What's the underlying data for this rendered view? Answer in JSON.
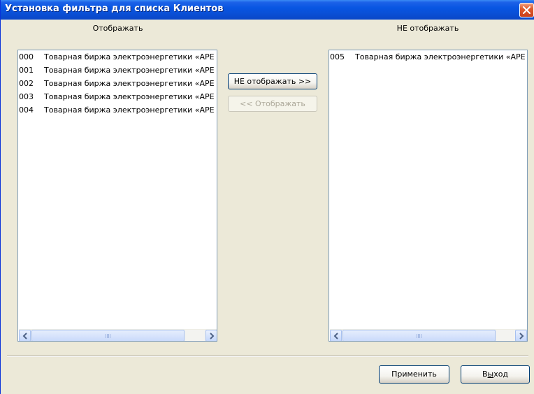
{
  "window": {
    "title": "Установка фильтра для списка Клиентов"
  },
  "left_panel": {
    "header": "Отображать",
    "items": [
      {
        "code": "000",
        "name": "Товарная биржа электроэнергетики «АРЕ"
      },
      {
        "code": "001",
        "name": "Товарная биржа электроэнергетики «АРЕ"
      },
      {
        "code": "002",
        "name": "Товарная биржа электроэнергетики «АРЕ"
      },
      {
        "code": "003",
        "name": "Товарная биржа электроэнергетики «АРЕ"
      },
      {
        "code": "004",
        "name": "Товарная биржа электроэнергетики «АРЕ"
      }
    ]
  },
  "right_panel": {
    "header": "НЕ отображать",
    "items": [
      {
        "code": "005",
        "name": "Товарная биржа электроэнергетики «АРЕ"
      }
    ]
  },
  "buttons": {
    "hide": "НЕ отображать >>",
    "show": "<< Отображать",
    "apply": "Применить",
    "exit_prefix": "В",
    "exit_mnemonic": "ы",
    "exit_suffix": "ход"
  },
  "colors": {
    "titlebar": "#0a4fd6",
    "dialog_bg": "#ece9d8",
    "list_border": "#7f9db9",
    "close_button": "#e05a2c"
  }
}
